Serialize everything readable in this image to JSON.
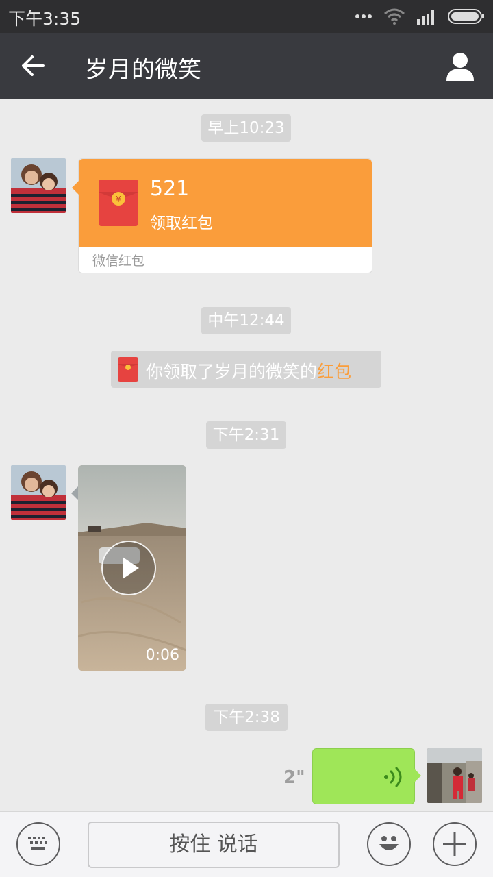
{
  "status_bar": {
    "time": "下午3:35",
    "icons": [
      "more-dots-icon",
      "wifi-icon",
      "signal-icon",
      "battery-icon"
    ]
  },
  "header": {
    "title": "岁月的微笑",
    "back_icon": "back-arrow-icon",
    "profile_icon": "person-icon"
  },
  "colors": {
    "accent_orange": "#fa9d3b",
    "voice_green": "#9fe658",
    "header_bg": "#393a3f",
    "chat_bg": "#ebebeb"
  },
  "messages": {
    "ts1": "早上10:23",
    "red_packet": {
      "amount": "521",
      "action": "领取红包",
      "footer": "微信红包"
    },
    "ts2": "中午12:44",
    "notice": {
      "text": "你领取了岁月的微笑的",
      "link": "红包"
    },
    "ts3": "下午2:31",
    "video": {
      "duration": "0:06"
    },
    "ts4": "下午2:38",
    "voice": {
      "length": "2\""
    }
  },
  "toolbar": {
    "hold_to_talk": "按住 说话",
    "icons": [
      "keyboard-icon",
      "emoji-icon",
      "plus-icon"
    ]
  }
}
